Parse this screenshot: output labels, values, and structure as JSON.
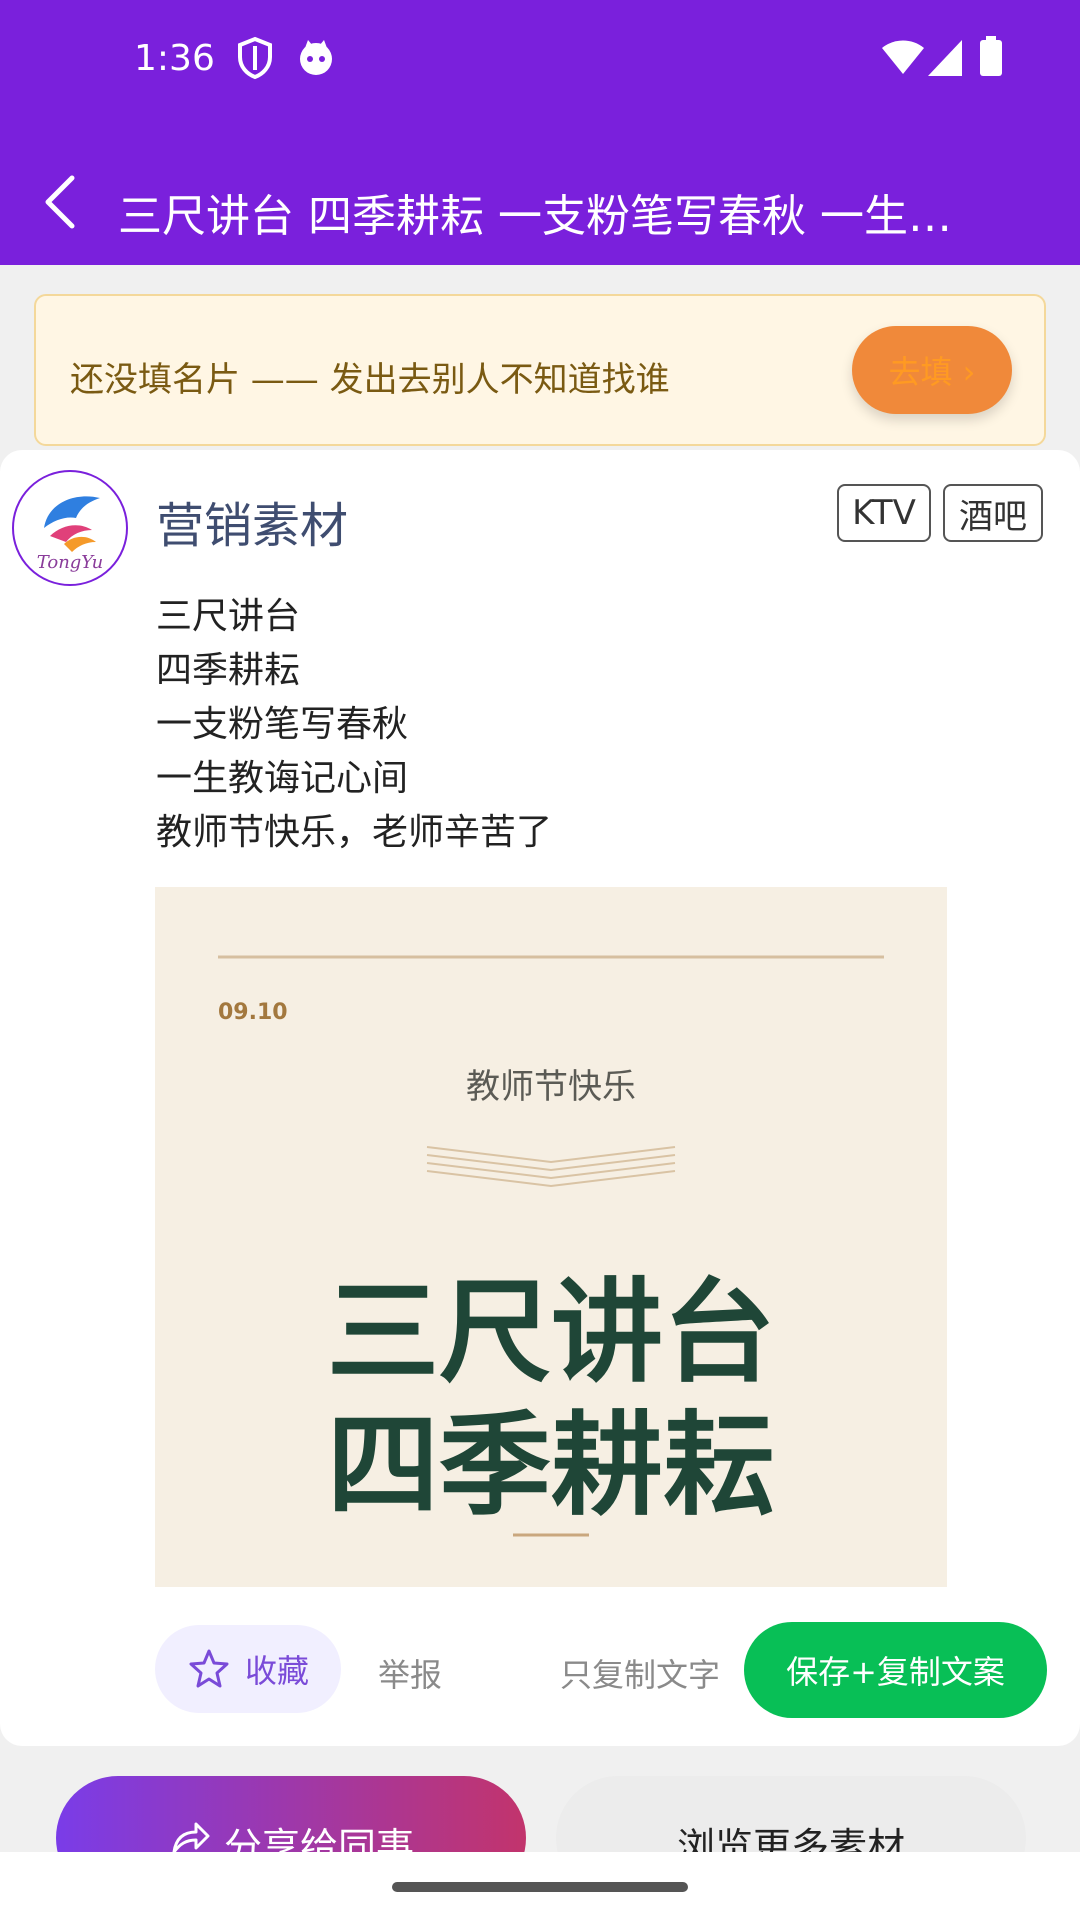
{
  "status_bar": {
    "time": "1:36"
  },
  "header": {
    "title": "三尺讲台 四季耕耘 一支粉笔写春秋 一生教诲记心间 教师节快乐，老师辛苦了"
  },
  "banner": {
    "text": "还没填名片 —— 发出去别人不知道找谁",
    "button_label": "去填 ›"
  },
  "post": {
    "author": "营销素材",
    "avatar_caption": "TongYu",
    "tags": [
      "KTV",
      "酒吧"
    ],
    "lines": [
      "三尺讲台",
      "四季耕耘",
      "一支粉笔写春秋",
      "一生教诲记心间",
      "教师节快乐，老师辛苦了"
    ],
    "poster": {
      "date": "09.10",
      "subtitle": "教师节快乐",
      "headline_1": "三尺讲台",
      "headline_2": "四季耕耘"
    }
  },
  "actions": {
    "favorite": "收藏",
    "report": "举报",
    "copy_text_only": "只复制文字",
    "save_and_copy": "保存+复制文案"
  },
  "footer": {
    "share": "分享给同事",
    "browse_more": "浏览更多素材"
  }
}
